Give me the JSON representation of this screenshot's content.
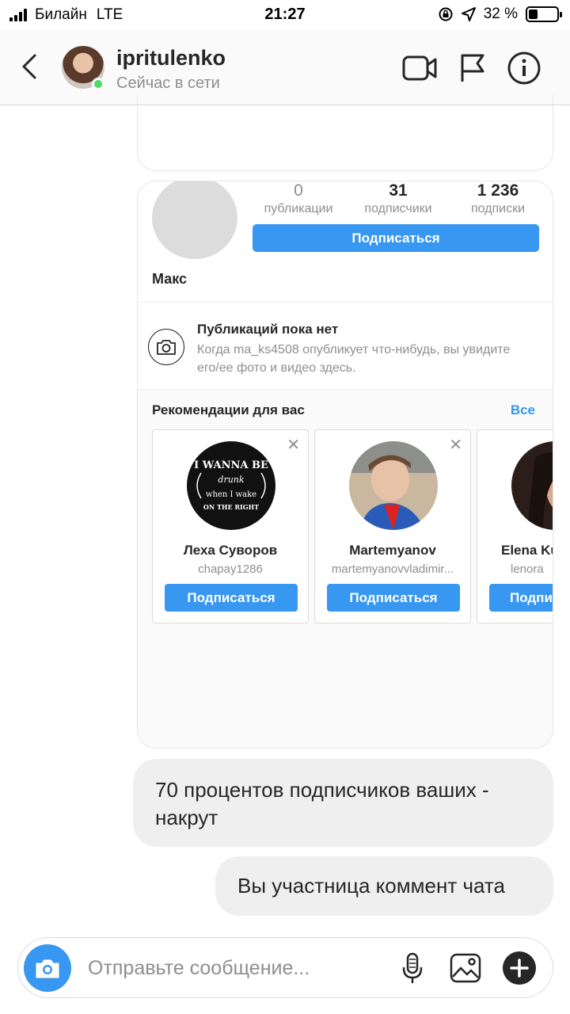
{
  "status_bar": {
    "carrier": "Билайн",
    "network": "LTE",
    "time": "21:27",
    "battery_percent_label": "32 %",
    "battery_level": 0.32
  },
  "header": {
    "username": "ipritulenko",
    "presence": "Сейчас в сети",
    "icons": [
      "back-chevron-icon",
      "video-call-icon",
      "flag-icon",
      "info-icon"
    ]
  },
  "profile_card": {
    "stats": [
      {
        "value": "0",
        "label": "публикации"
      },
      {
        "value": "31",
        "label": "подписчики"
      },
      {
        "value": "1 236",
        "label": "подписки"
      }
    ],
    "follow_label": "Подписаться",
    "name": "Макс",
    "no_posts_title": "Публикаций пока нет",
    "no_posts_desc": "Когда ma_ks4508 опубликует что-нибудь, вы увидите его/ее фото и видео здесь.",
    "recommendations_title": "Рекомендации для вас",
    "recommendations_all": "Все",
    "recommendations": [
      {
        "name": "Леха Суворов",
        "handle": "chapay1286",
        "follow_label": "Подписаться",
        "close": "✕",
        "avatar_text": [
          "I WANNA BE",
          "drunk",
          "when I wake",
          "ON THE RIGHT"
        ]
      },
      {
        "name": "Martemyanov",
        "handle": "martemyanovvladimir...",
        "follow_label": "Подписаться",
        "close": "✕"
      },
      {
        "name": "Elena Ku",
        "handle": "lenora",
        "follow_label": "Подпи"
      }
    ]
  },
  "messages": [
    {
      "text": "70 процентов подписчиков ваших - накрут"
    },
    {
      "text": "Вы участница коммент чата"
    }
  ],
  "composer": {
    "placeholder": "Отправьте сообщение...",
    "icons": [
      "camera-icon",
      "microphone-icon",
      "gallery-icon",
      "plus-icon"
    ]
  },
  "colors": {
    "accent": "#3897f0",
    "online": "#4cd964",
    "bubble": "#efefef",
    "secondary_text": "#8e8e8e"
  }
}
